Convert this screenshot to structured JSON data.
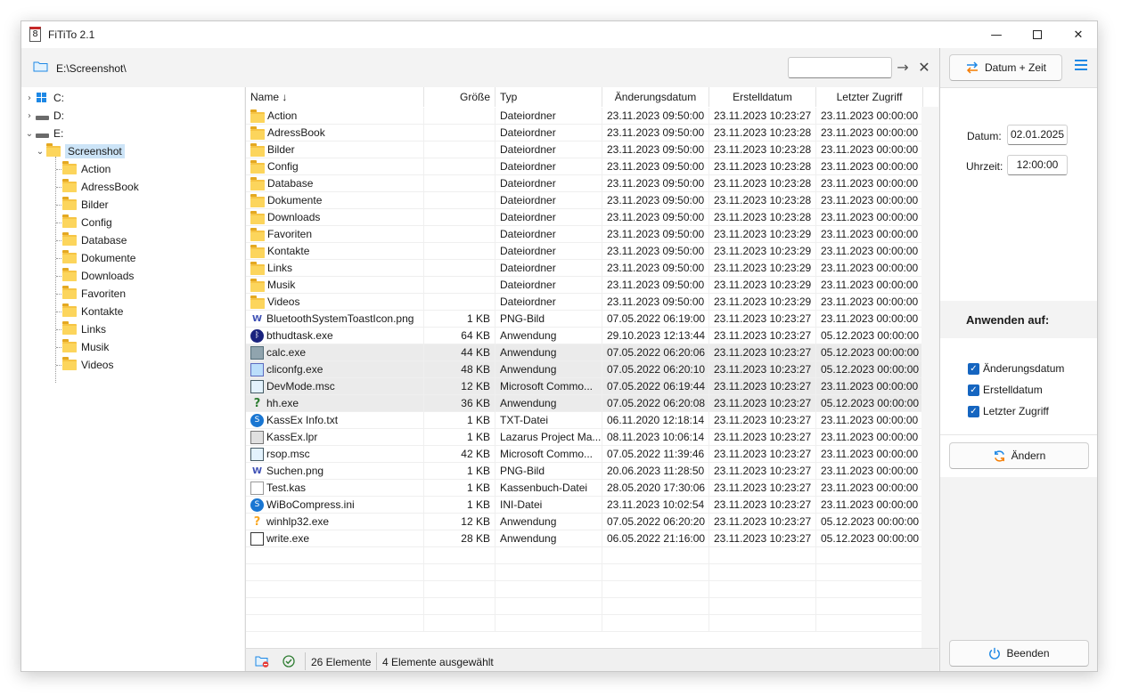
{
  "window": {
    "title": "FiTiTo 2.1",
    "app_icon_glyph": "8"
  },
  "path": {
    "text": "E:\\Screenshot\\",
    "search_value": ""
  },
  "tree": {
    "drives": [
      {
        "label": "C:",
        "icon": "windows-drive-icon"
      },
      {
        "label": "D:",
        "icon": "drive-icon"
      },
      {
        "label": "E:",
        "icon": "drive-icon"
      }
    ],
    "selected": "Screenshot",
    "children": [
      "Action",
      "AdressBook",
      "Bilder",
      "Config",
      "Database",
      "Dokumente",
      "Downloads",
      "Favoriten",
      "Kontakte",
      "Links",
      "Musik",
      "Videos"
    ]
  },
  "columns": {
    "name": "Name",
    "size": "Größe",
    "type": "Typ",
    "modified": "Änderungsdatum",
    "created": "Erstelldatum",
    "accessed": "Letzter Zugriff",
    "sort_indicator": "↓"
  },
  "files": [
    {
      "name": "Action",
      "size": "",
      "type": "Dateiordner",
      "modified": "23.11.2023 09:50:00",
      "created": "23.11.2023 10:23:27",
      "accessed": "23.11.2023 00:00:00",
      "icon": "folder",
      "selected": false
    },
    {
      "name": "AdressBook",
      "size": "",
      "type": "Dateiordner",
      "modified": "23.11.2023 09:50:00",
      "created": "23.11.2023 10:23:28",
      "accessed": "23.11.2023 00:00:00",
      "icon": "folder",
      "selected": false
    },
    {
      "name": "Bilder",
      "size": "",
      "type": "Dateiordner",
      "modified": "23.11.2023 09:50:00",
      "created": "23.11.2023 10:23:28",
      "accessed": "23.11.2023 00:00:00",
      "icon": "folder",
      "selected": false
    },
    {
      "name": "Config",
      "size": "",
      "type": "Dateiordner",
      "modified": "23.11.2023 09:50:00",
      "created": "23.11.2023 10:23:28",
      "accessed": "23.11.2023 00:00:00",
      "icon": "folder",
      "selected": false
    },
    {
      "name": "Database",
      "size": "",
      "type": "Dateiordner",
      "modified": "23.11.2023 09:50:00",
      "created": "23.11.2023 10:23:28",
      "accessed": "23.11.2023 00:00:00",
      "icon": "folder",
      "selected": false
    },
    {
      "name": "Dokumente",
      "size": "",
      "type": "Dateiordner",
      "modified": "23.11.2023 09:50:00",
      "created": "23.11.2023 10:23:28",
      "accessed": "23.11.2023 00:00:00",
      "icon": "folder",
      "selected": false
    },
    {
      "name": "Downloads",
      "size": "",
      "type": "Dateiordner",
      "modified": "23.11.2023 09:50:00",
      "created": "23.11.2023 10:23:28",
      "accessed": "23.11.2023 00:00:00",
      "icon": "folder",
      "selected": false
    },
    {
      "name": "Favoriten",
      "size": "",
      "type": "Dateiordner",
      "modified": "23.11.2023 09:50:00",
      "created": "23.11.2023 10:23:29",
      "accessed": "23.11.2023 00:00:00",
      "icon": "folder",
      "selected": false
    },
    {
      "name": "Kontakte",
      "size": "",
      "type": "Dateiordner",
      "modified": "23.11.2023 09:50:00",
      "created": "23.11.2023 10:23:29",
      "accessed": "23.11.2023 00:00:00",
      "icon": "folder",
      "selected": false
    },
    {
      "name": "Links",
      "size": "",
      "type": "Dateiordner",
      "modified": "23.11.2023 09:50:00",
      "created": "23.11.2023 10:23:29",
      "accessed": "23.11.2023 00:00:00",
      "icon": "folder",
      "selected": false
    },
    {
      "name": "Musik",
      "size": "",
      "type": "Dateiordner",
      "modified": "23.11.2023 09:50:00",
      "created": "23.11.2023 10:23:29",
      "accessed": "23.11.2023 00:00:00",
      "icon": "folder",
      "selected": false
    },
    {
      "name": "Videos",
      "size": "",
      "type": "Dateiordner",
      "modified": "23.11.2023 09:50:00",
      "created": "23.11.2023 10:23:29",
      "accessed": "23.11.2023 00:00:00",
      "icon": "folder",
      "selected": false
    },
    {
      "name": "BluetoothSystemToastIcon.png",
      "size": "1 KB",
      "type": "PNG-Bild",
      "modified": "07.05.2022 06:19:00",
      "created": "23.11.2023 10:23:27",
      "accessed": "23.11.2023 00:00:00",
      "icon": "png",
      "selected": false
    },
    {
      "name": "bthudtask.exe",
      "size": "64 KB",
      "type": "Anwendung",
      "modified": "29.10.2023 12:13:44",
      "created": "23.11.2023 10:23:27",
      "accessed": "05.12.2023 00:00:00",
      "icon": "bt",
      "selected": false
    },
    {
      "name": "calc.exe",
      "size": "44 KB",
      "type": "Anwendung",
      "modified": "07.05.2022 06:20:06",
      "created": "23.11.2023 10:23:27",
      "accessed": "05.12.2023 00:00:00",
      "icon": "calc",
      "selected": true
    },
    {
      "name": "cliconfg.exe",
      "size": "48 KB",
      "type": "Anwendung",
      "modified": "07.05.2022 06:20:10",
      "created": "23.11.2023 10:23:27",
      "accessed": "05.12.2023 00:00:00",
      "icon": "app",
      "selected": true
    },
    {
      "name": "DevMode.msc",
      "size": "12 KB",
      "type": "Microsoft Commo...",
      "modified": "07.05.2022 06:19:44",
      "created": "23.11.2023 10:23:27",
      "accessed": "23.11.2023 00:00:00",
      "icon": "msc",
      "selected": true
    },
    {
      "name": "hh.exe",
      "size": "36 KB",
      "type": "Anwendung",
      "modified": "07.05.2022 06:20:08",
      "created": "23.11.2023 10:23:27",
      "accessed": "05.12.2023 00:00:00",
      "icon": "help",
      "selected": true
    },
    {
      "name": "KassEx Info.txt",
      "size": "1 KB",
      "type": "TXT-Datei",
      "modified": "06.11.2020 12:18:14",
      "created": "23.11.2023 10:23:27",
      "accessed": "23.11.2023 00:00:00",
      "icon": "kass",
      "selected": false
    },
    {
      "name": "KassEx.lpr",
      "size": "1 KB",
      "type": "Lazarus Project Ma...",
      "modified": "08.11.2023 10:06:14",
      "created": "23.11.2023 10:23:27",
      "accessed": "23.11.2023 00:00:00",
      "icon": "lpr",
      "selected": false
    },
    {
      "name": "rsop.msc",
      "size": "42 KB",
      "type": "Microsoft Commo...",
      "modified": "07.05.2022 11:39:46",
      "created": "23.11.2023 10:23:27",
      "accessed": "23.11.2023 00:00:00",
      "icon": "msc",
      "selected": false
    },
    {
      "name": "Suchen.png",
      "size": "1 KB",
      "type": "PNG-Bild",
      "modified": "20.06.2023 11:28:50",
      "created": "23.11.2023 10:23:27",
      "accessed": "23.11.2023 00:00:00",
      "icon": "png",
      "selected": false
    },
    {
      "name": "Test.kas",
      "size": "1 KB",
      "type": "Kassenbuch-Datei",
      "modified": "28.05.2020 17:30:06",
      "created": "23.11.2023 10:23:27",
      "accessed": "23.11.2023 00:00:00",
      "icon": "kas",
      "selected": false
    },
    {
      "name": "WiBoCompress.ini",
      "size": "1 KB",
      "type": "INI-Datei",
      "modified": "23.11.2023 10:02:54",
      "created": "23.11.2023 10:23:27",
      "accessed": "23.11.2023 00:00:00",
      "icon": "kass",
      "selected": false
    },
    {
      "name": "winhlp32.exe",
      "size": "12 KB",
      "type": "Anwendung",
      "modified": "07.05.2022 06:20:20",
      "created": "23.11.2023 10:23:27",
      "accessed": "05.12.2023 00:00:00",
      "icon": "help-y",
      "selected": false
    },
    {
      "name": "write.exe",
      "size": "28 KB",
      "type": "Anwendung",
      "modified": "06.05.2022 21:16:00",
      "created": "23.11.2023 10:23:27",
      "accessed": "05.12.2023 00:00:00",
      "icon": "write",
      "selected": false
    }
  ],
  "status": {
    "count_text": "26 Elemente",
    "selection_text": "4 Elemente ausgewählt"
  },
  "panel": {
    "mode_button": "Datum + Zeit",
    "date_label": "Datum:",
    "date_value": "02.01.2025",
    "time_label": "Uhrzeit:",
    "time_value": "12:00:00",
    "apply_title": "Anwenden auf:",
    "checkboxes": [
      {
        "label": "Änderungsdatum",
        "checked": true
      },
      {
        "label": "Erstelldatum",
        "checked": true
      },
      {
        "label": "Letzter Zugriff",
        "checked": true
      }
    ],
    "change_button": "Ändern",
    "exit_button": "Beenden"
  },
  "colors": {
    "accent": "#1e88e5",
    "selection": "#cce4f7",
    "folder": "#f6c444"
  }
}
